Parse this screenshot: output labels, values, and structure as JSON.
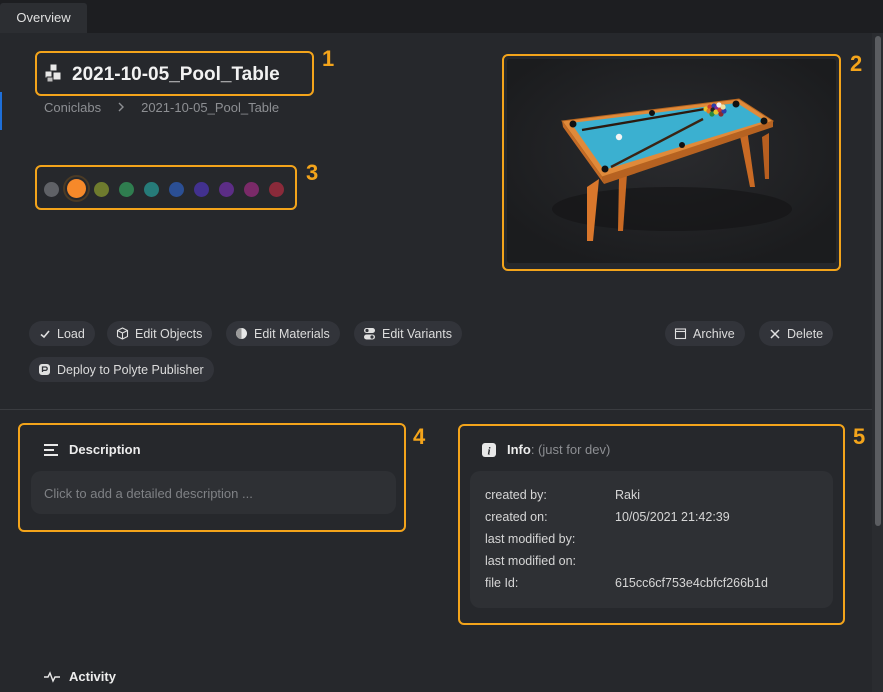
{
  "tabs": [
    {
      "label": "Overview"
    }
  ],
  "header": {
    "title": "2021-10-05_Pool_Table",
    "breadcrumb": [
      "Coniclabs",
      "2021-10-05_Pool_Table"
    ]
  },
  "color_tags": [
    {
      "color": "#5f6166",
      "selected": false
    },
    {
      "color": "#f6892a",
      "selected": true
    },
    {
      "color": "#6e7b2e",
      "selected": false
    },
    {
      "color": "#2f7d4f",
      "selected": false
    },
    {
      "color": "#267b79",
      "selected": false
    },
    {
      "color": "#2b4f94",
      "selected": false
    },
    {
      "color": "#42318f",
      "selected": false
    },
    {
      "color": "#5c2d86",
      "selected": false
    },
    {
      "color": "#7a2a68",
      "selected": false
    },
    {
      "color": "#8a2a3a",
      "selected": false
    }
  ],
  "actions": {
    "load": "Load",
    "edit_objects": "Edit Objects",
    "edit_materials": "Edit Materials",
    "edit_variants": "Edit Variants",
    "archive": "Archive",
    "delete": "Delete",
    "deploy": "Deploy to Polyte Publisher"
  },
  "description": {
    "title": "Description",
    "placeholder": "Click to add a detailed description ..."
  },
  "info": {
    "title": "Info",
    "subtitle": ": (just for dev)",
    "rows": [
      {
        "label": "created by:",
        "value": "Raki"
      },
      {
        "label": "created on:",
        "value": "10/05/2021 21:42:39"
      },
      {
        "label": "last modified by:",
        "value": ""
      },
      {
        "label": "last modified on:",
        "value": ""
      },
      {
        "label": "file Id:",
        "value": "615cc6cf753e4cbfcf266b1d"
      }
    ]
  },
  "activity": {
    "title": "Activity"
  },
  "annotations": [
    "1",
    "2",
    "3",
    "4",
    "5"
  ],
  "colors": {
    "annotation": "#f3a41b",
    "table_felt": "#3bb0d0",
    "table_wood": "#e08a3a"
  }
}
